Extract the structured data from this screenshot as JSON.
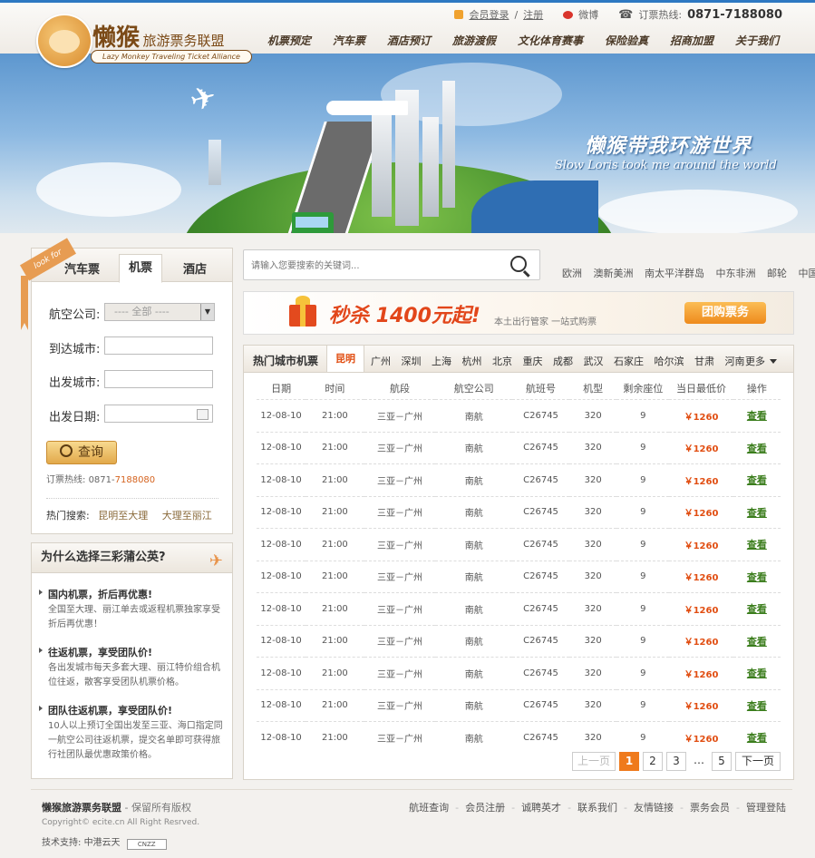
{
  "header": {
    "logo_cn_big": "懒猴",
    "logo_cn_small": "旅游票务联盟",
    "logo_en": "Lazy Monkey Traveling Ticket Alliance",
    "member_login": "会员登录",
    "register": "注册",
    "weibo": "微博",
    "hotline_label": "订票热线:",
    "hotline_number": "0871-7188080",
    "nav": [
      "机票预定",
      "汽车票",
      "酒店预订",
      "旅游渡假",
      "文化体育赛事",
      "保险验真",
      "招商加盟",
      "关于我们"
    ]
  },
  "banner": {
    "slogan_cn": "懒猴带我环游世界",
    "slogan_en": "Slow Loris took me around the world"
  },
  "search_panel": {
    "ribbon": "look for",
    "tabs": [
      "汽车票",
      "机票",
      "酒店"
    ],
    "active_tab": "机票",
    "airline_label": "航空公司:",
    "airline_value": "---- 全部 ----",
    "arrive_label": "到达城市:",
    "depart_label": "出发城市:",
    "date_label": "出发日期:",
    "query_button": "查询",
    "hotline_label": "订票热线:",
    "hotline_prefix": "0871-",
    "hotline_number": "7188080",
    "hot_search_label": "热门搜索:",
    "hot_search_links": [
      "昆明至大理",
      "大理至丽江"
    ]
  },
  "why": {
    "title": "为什么选择三彩蒲公英?",
    "items": [
      {
        "title": "国内机票，折后再优惠!",
        "desc": "全国至大理、丽江单去或返程机票独家享受折后再优惠！"
      },
      {
        "title": "往返机票，享受团队价!",
        "desc": "各出发城市每天多套大理、丽江特价组合机位往返，散客享受团队机票价格。"
      },
      {
        "title": "团队往返机票，享受团队价!",
        "desc": "10人以上预订全国出发至三亚、海口指定同一航空公司往返机票，提交名单即可获得旅行社团队最优惠政策价格。"
      }
    ]
  },
  "search": {
    "placeholder": "请输入您要搜索的关键词..."
  },
  "regions": [
    "欧洲",
    "澳新美洲",
    "南太平洋群岛",
    "中东非洲",
    "邮轮",
    "中国"
  ],
  "promo": {
    "title": "秒杀 1400元起!",
    "subtitle": "本土出行管家 一站式购票",
    "button": "团购票务"
  },
  "flights": {
    "tab_title": "热门城市机票",
    "active_city": "昆明",
    "cities": [
      "广州",
      "深圳",
      "上海",
      "杭州",
      "北京",
      "重庆",
      "成都",
      "武汉",
      "石家庄",
      "哈尔滨",
      "甘肃",
      "河南"
    ],
    "more": "更多",
    "columns": [
      "日期",
      "时间",
      "航段",
      "航空公司",
      "航班号",
      "机型",
      "剩余座位",
      "当日最低价",
      "操作"
    ],
    "rows": [
      [
        "12-08-10",
        "21:00",
        "三亚－广州",
        "南航",
        "C26745",
        "320",
        "9",
        "￥1260",
        "查看"
      ],
      [
        "12-08-10",
        "21:00",
        "三亚－广州",
        "南航",
        "C26745",
        "320",
        "9",
        "￥1260",
        "查看"
      ],
      [
        "12-08-10",
        "21:00",
        "三亚－广州",
        "南航",
        "C26745",
        "320",
        "9",
        "￥1260",
        "查看"
      ],
      [
        "12-08-10",
        "21:00",
        "三亚－广州",
        "南航",
        "C26745",
        "320",
        "9",
        "￥1260",
        "查看"
      ],
      [
        "12-08-10",
        "21:00",
        "三亚－广州",
        "南航",
        "C26745",
        "320",
        "9",
        "￥1260",
        "查看"
      ],
      [
        "12-08-10",
        "21:00",
        "三亚－广州",
        "南航",
        "C26745",
        "320",
        "9",
        "￥1260",
        "查看"
      ],
      [
        "12-08-10",
        "21:00",
        "三亚－广州",
        "南航",
        "C26745",
        "320",
        "9",
        "￥1260",
        "查看"
      ],
      [
        "12-08-10",
        "21:00",
        "三亚－广州",
        "南航",
        "C26745",
        "320",
        "9",
        "￥1260",
        "查看"
      ],
      [
        "12-08-10",
        "21:00",
        "三亚－广州",
        "南航",
        "C26745",
        "320",
        "9",
        "￥1260",
        "查看"
      ],
      [
        "12-08-10",
        "21:00",
        "三亚－广州",
        "南航",
        "C26745",
        "320",
        "9",
        "￥1260",
        "查看"
      ],
      [
        "12-08-10",
        "21:00",
        "三亚－广州",
        "南航",
        "C26745",
        "320",
        "9",
        "￥1260",
        "查看"
      ]
    ],
    "pager": {
      "prev": "上一页",
      "pages": [
        "1",
        "2",
        "3"
      ],
      "dots": "…",
      "last": "5",
      "next": "下一页"
    }
  },
  "footer": {
    "brand": "懒猴旅游票务联盟",
    "rights": " - 保留所有版权",
    "copyright": "Copyright© ecite.cn All Right Resrved.",
    "tech_label": "技术支持:",
    "tech_name": "中港云天",
    "cnzz": "CNZZ",
    "links": [
      "航班查询",
      "会员注册",
      "诚聘英才",
      "联系我们",
      "友情链接",
      "票务会员",
      "管理登陆"
    ]
  }
}
